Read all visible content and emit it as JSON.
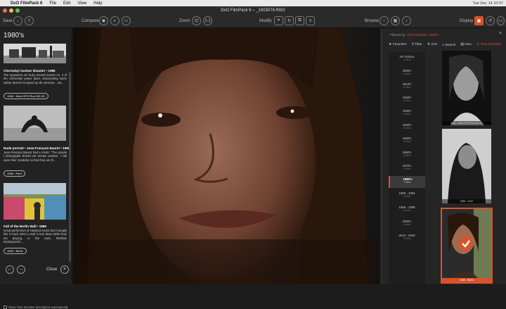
{
  "menubar": {
    "app_name": "DxO FilmPack 6",
    "items": [
      "File",
      "Edit",
      "View",
      "Help"
    ],
    "clock": "Tue Dec 14  10:07"
  },
  "toolbar": {
    "document_title": "DxO FilmPack 6 – _1003074.RW2",
    "save_label": "Save",
    "compare_label": "Compare",
    "zoom_label": "Zoom",
    "modify_label": "Modify",
    "browse_label": "Browse",
    "display_label": "Display"
  },
  "time_machine": {
    "decade_title": "1980's",
    "cards": [
      {
        "title": "Chernobyl nuclear disaster • 1986",
        "description": "The engineers are busy around reactor no. 4 of the Chernobyl power plant, deactivating some safety devices to speed up the process... wit...",
        "tag": "1986 - Ilford HPS Plus 400 HC"
      },
      {
        "title": "Nude portrait • Jean-François Bauret • 1986",
        "description": "Jean-François Bauret had a credo: \"The people I photograph should not remain passive. I call upon their creativity so that they are th...",
        "tag": "1986 - Panf"
      },
      {
        "title": "Fall of the Berlin Wall • 1989",
        "description": "Great performers of classical music don't usually like it much when a wall is torn down while they are playing. In this case, Mstislav Rostropovich...",
        "tag": "1989 - Berlin"
      }
    ],
    "close_label": "Close",
    "show_description_label": "Show Time Machine description automatically"
  },
  "browser": {
    "filter_prefix": "Filtered by:",
    "filter_value": "Time Machine: 1980's",
    "tabs": [
      "Favorites",
      "Filter",
      "Sort",
      "Search",
      "New",
      "Time Machine"
    ],
    "decades": [
      {
        "label": "19 Century",
        "sub": "xx films"
      },
      {
        "label": "1900's",
        "sub": "xx films"
      },
      {
        "label": "1910's",
        "sub": "xx films"
      },
      {
        "label": "1920's",
        "sub": "xx films"
      },
      {
        "label": "1930's",
        "sub": "xx films"
      },
      {
        "label": "1940's",
        "sub": "xx films"
      },
      {
        "label": "1950's",
        "sub": "xx films"
      },
      {
        "label": "1960's",
        "sub": "xx films"
      },
      {
        "label": "1970's",
        "sub": "xx films"
      },
      {
        "label": "1980's",
        "sub": "9 films"
      },
      {
        "label": "1990 - 1994",
        "sub": "xx films"
      },
      {
        "label": "1995 - 1999",
        "sub": "xx films"
      },
      {
        "label": "2000's",
        "sub": "xx films"
      },
      {
        "label": "2010 - 2020",
        "sub": "xx films"
      }
    ],
    "selected_decade_index": 9,
    "thumbnails": [
      {
        "caption": "1986 - Ilford HPS Plus 400 HC"
      },
      {
        "caption": "1986 - PanF"
      },
      {
        "caption": "1989 - Berlin"
      }
    ],
    "selected_thumbnail_index": 2
  },
  "colors": {
    "accent": "#d8532b",
    "panel": "#222222",
    "toolbar": "#2a2a2a"
  }
}
